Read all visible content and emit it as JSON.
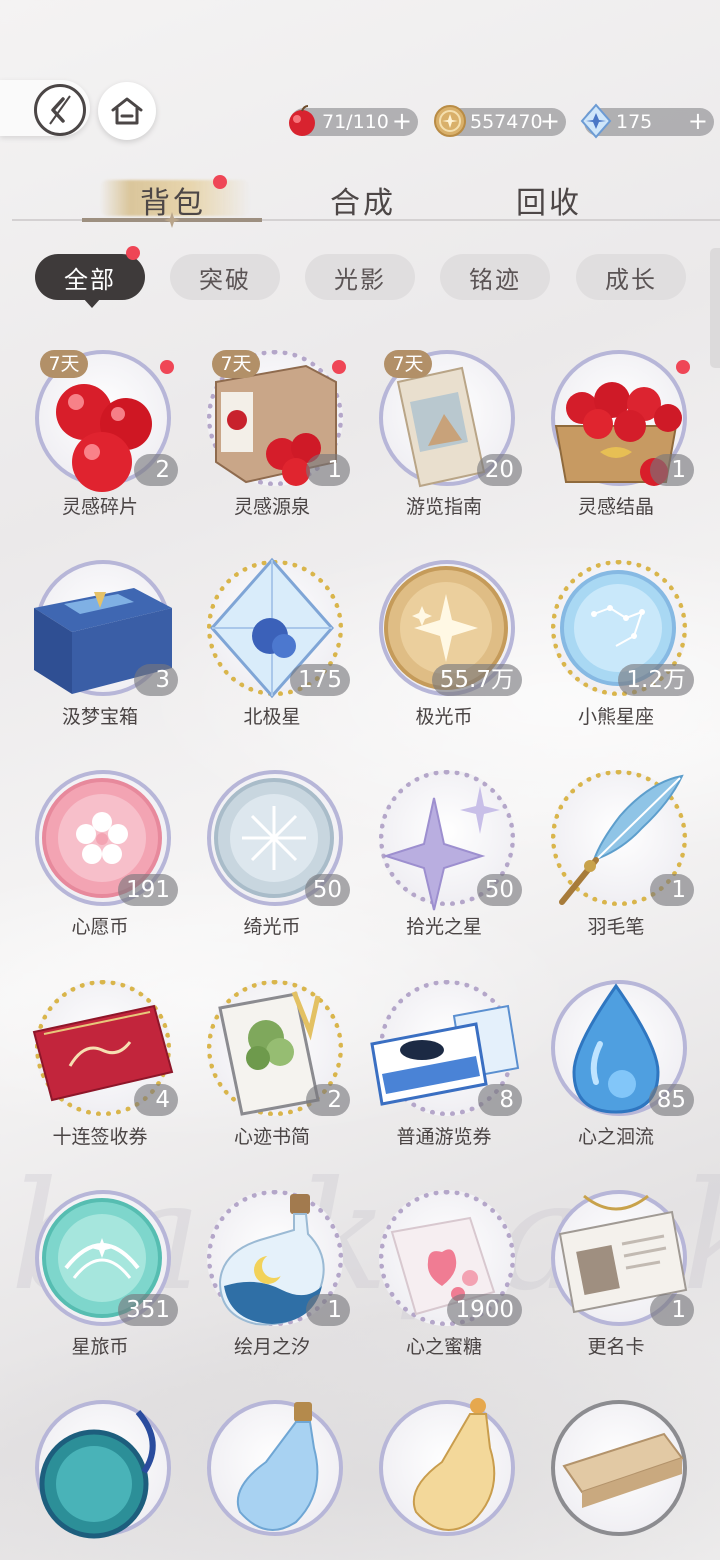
{
  "top_bar": {
    "currencies": [
      {
        "icon": "apple-icon",
        "value": "71/110",
        "plus": "+"
      },
      {
        "icon": "gold-coin-icon",
        "value": "557470",
        "plus": "+"
      },
      {
        "icon": "crystal-star-icon",
        "value": "175",
        "plus": "+"
      }
    ]
  },
  "main_tabs": [
    {
      "label": "背包",
      "active": true
    },
    {
      "label": "合成",
      "active": false
    },
    {
      "label": "回收",
      "active": false
    }
  ],
  "filters": [
    {
      "label": "全部",
      "active": true
    },
    {
      "label": "突破",
      "active": false
    },
    {
      "label": "光影",
      "active": false
    },
    {
      "label": "铭迹",
      "active": false
    },
    {
      "label": "成长",
      "active": false
    }
  ],
  "watermark_text": "backpack",
  "items": [
    {
      "name": "灵感碎片",
      "count": "2",
      "tag": "7天",
      "icon": "red-apples-icon"
    },
    {
      "name": "灵感源泉",
      "count": "1",
      "tag": "7天",
      "icon": "apple-box-icon"
    },
    {
      "name": "游览指南",
      "count": "20",
      "tag": "7天",
      "icon": "guide-book-icon"
    },
    {
      "name": "灵感结晶",
      "count": "1",
      "tag": "",
      "icon": "apple-basket-icon"
    },
    {
      "name": "汲梦宝箱",
      "count": "3",
      "tag": "",
      "icon": "dream-chest-icon"
    },
    {
      "name": "北极星",
      "count": "175",
      "tag": "",
      "icon": "crystal-star-icon"
    },
    {
      "name": "极光币",
      "count": "55.7万",
      "tag": "",
      "icon": "gold-coin-icon"
    },
    {
      "name": "小熊星座",
      "count": "1.2万",
      "tag": "",
      "icon": "constellation-coin-icon"
    },
    {
      "name": "心愿币",
      "count": "191",
      "tag": "",
      "icon": "sakura-coin-icon"
    },
    {
      "name": "绮光币",
      "count": "50",
      "tag": "",
      "icon": "silver-coin-icon"
    },
    {
      "name": "拾光之星",
      "count": "50",
      "tag": "",
      "icon": "sparkle-star-icon"
    },
    {
      "name": "羽毛笔",
      "count": "1",
      "tag": "",
      "icon": "quill-pen-icon"
    },
    {
      "name": "十连签收券",
      "count": "4",
      "tag": "",
      "icon": "red-card-icon"
    },
    {
      "name": "心迹书简",
      "count": "2",
      "tag": "",
      "icon": "letter-icon"
    },
    {
      "name": "普通游览券",
      "count": "8",
      "tag": "",
      "icon": "ticket-icon"
    },
    {
      "name": "心之洄流",
      "count": "85",
      "tag": "",
      "icon": "water-drop-icon"
    },
    {
      "name": "星旅币",
      "count": "351",
      "tag": "",
      "icon": "teal-coin-icon"
    },
    {
      "name": "绘月之汐",
      "count": "1",
      "tag": "",
      "icon": "moon-bottle-icon"
    },
    {
      "name": "心之蜜糖",
      "count": "1900",
      "tag": "",
      "icon": "candy-icon"
    },
    {
      "name": "更名卡",
      "count": "1",
      "tag": "",
      "icon": "id-card-icon"
    },
    {
      "name": "",
      "count": "",
      "tag": "",
      "icon": "pocket-watch-icon"
    },
    {
      "name": "",
      "count": "",
      "tag": "",
      "icon": "blue-potion-icon"
    },
    {
      "name": "",
      "count": "",
      "tag": "",
      "icon": "gold-potion-icon"
    },
    {
      "name": "",
      "count": "",
      "tag": "",
      "icon": "wood-plank-icon"
    }
  ]
}
